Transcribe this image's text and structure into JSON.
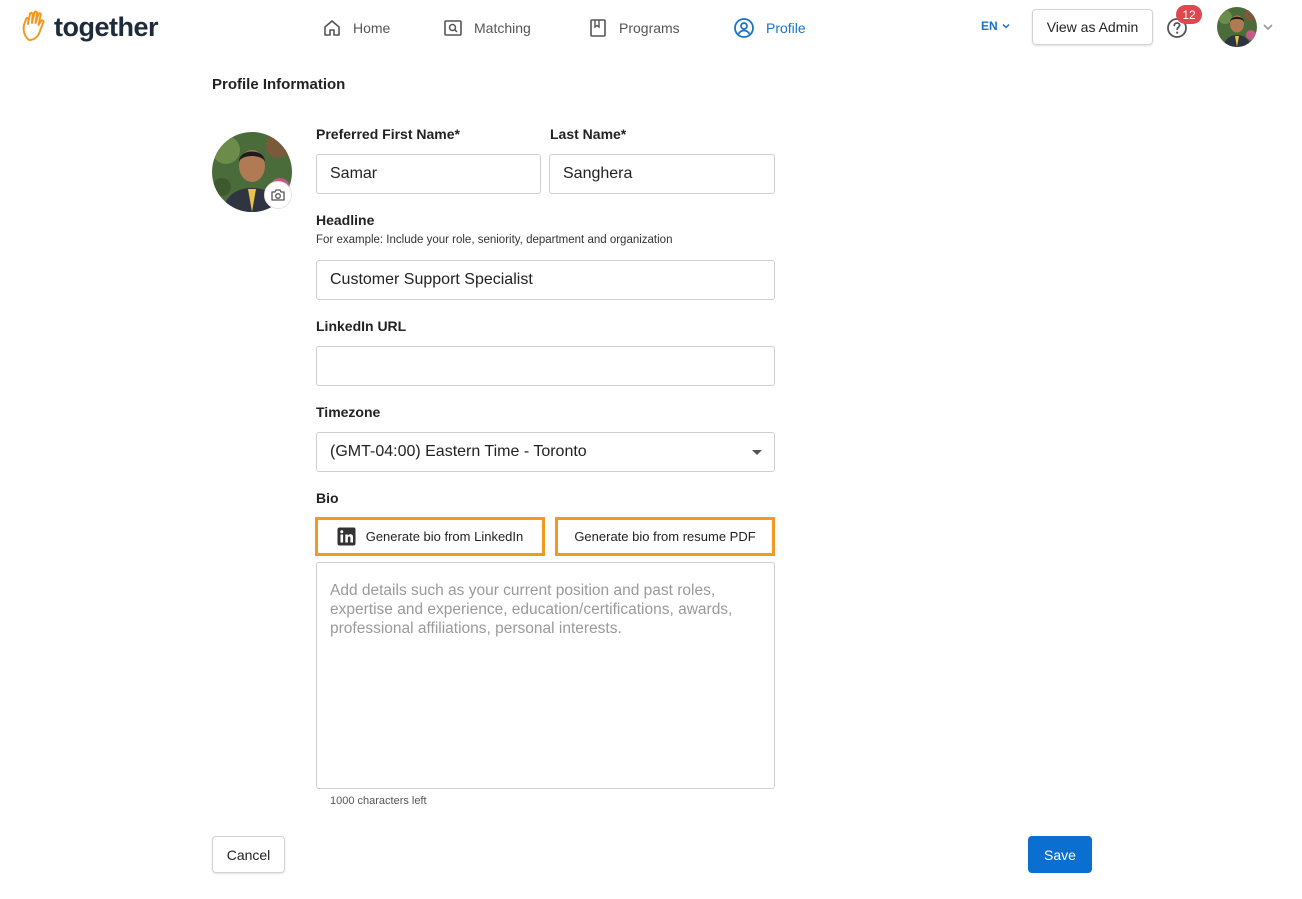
{
  "brand": {
    "name": "together",
    "icon": "hand-wave-icon",
    "accent": "#f29a1f"
  },
  "nav": {
    "items": [
      {
        "label": "Home",
        "icon": "home-icon",
        "active": false
      },
      {
        "label": "Matching",
        "icon": "matching-icon",
        "active": false
      },
      {
        "label": "Programs",
        "icon": "book-icon",
        "active": false
      },
      {
        "label": "Profile",
        "icon": "user-circle-icon",
        "active": true
      }
    ],
    "active_color": "#1a73c8"
  },
  "header": {
    "language": "EN",
    "admin_button": "View as Admin",
    "help_badge_count": "12",
    "help_icon": "help-circle-icon"
  },
  "profile": {
    "section_title": "Profile Information",
    "first_name": {
      "label": "Preferred First Name*",
      "value": "Samar"
    },
    "last_name": {
      "label": "Last Name*",
      "value": "Sanghera"
    },
    "headline": {
      "label": "Headline",
      "hint": "For example: Include your role, seniority, department and organization",
      "value": "Customer Support Specialist"
    },
    "linkedin": {
      "label": "LinkedIn URL",
      "value": ""
    },
    "timezone": {
      "label": "Timezone",
      "value": "(GMT-04:00) Eastern Time - Toronto"
    },
    "bio": {
      "label": "Bio",
      "generate_linkedin": "Generate bio from LinkedIn",
      "generate_pdf": "Generate bio from resume PDF",
      "placeholder": "Add details such as your current position and past roles, expertise and experience, education/certifications, awards, professional affiliations, personal interests.",
      "chars_left": "1000 characters left"
    }
  },
  "actions": {
    "cancel": "Cancel",
    "save": "Save",
    "save_color": "#0b6fd1"
  }
}
